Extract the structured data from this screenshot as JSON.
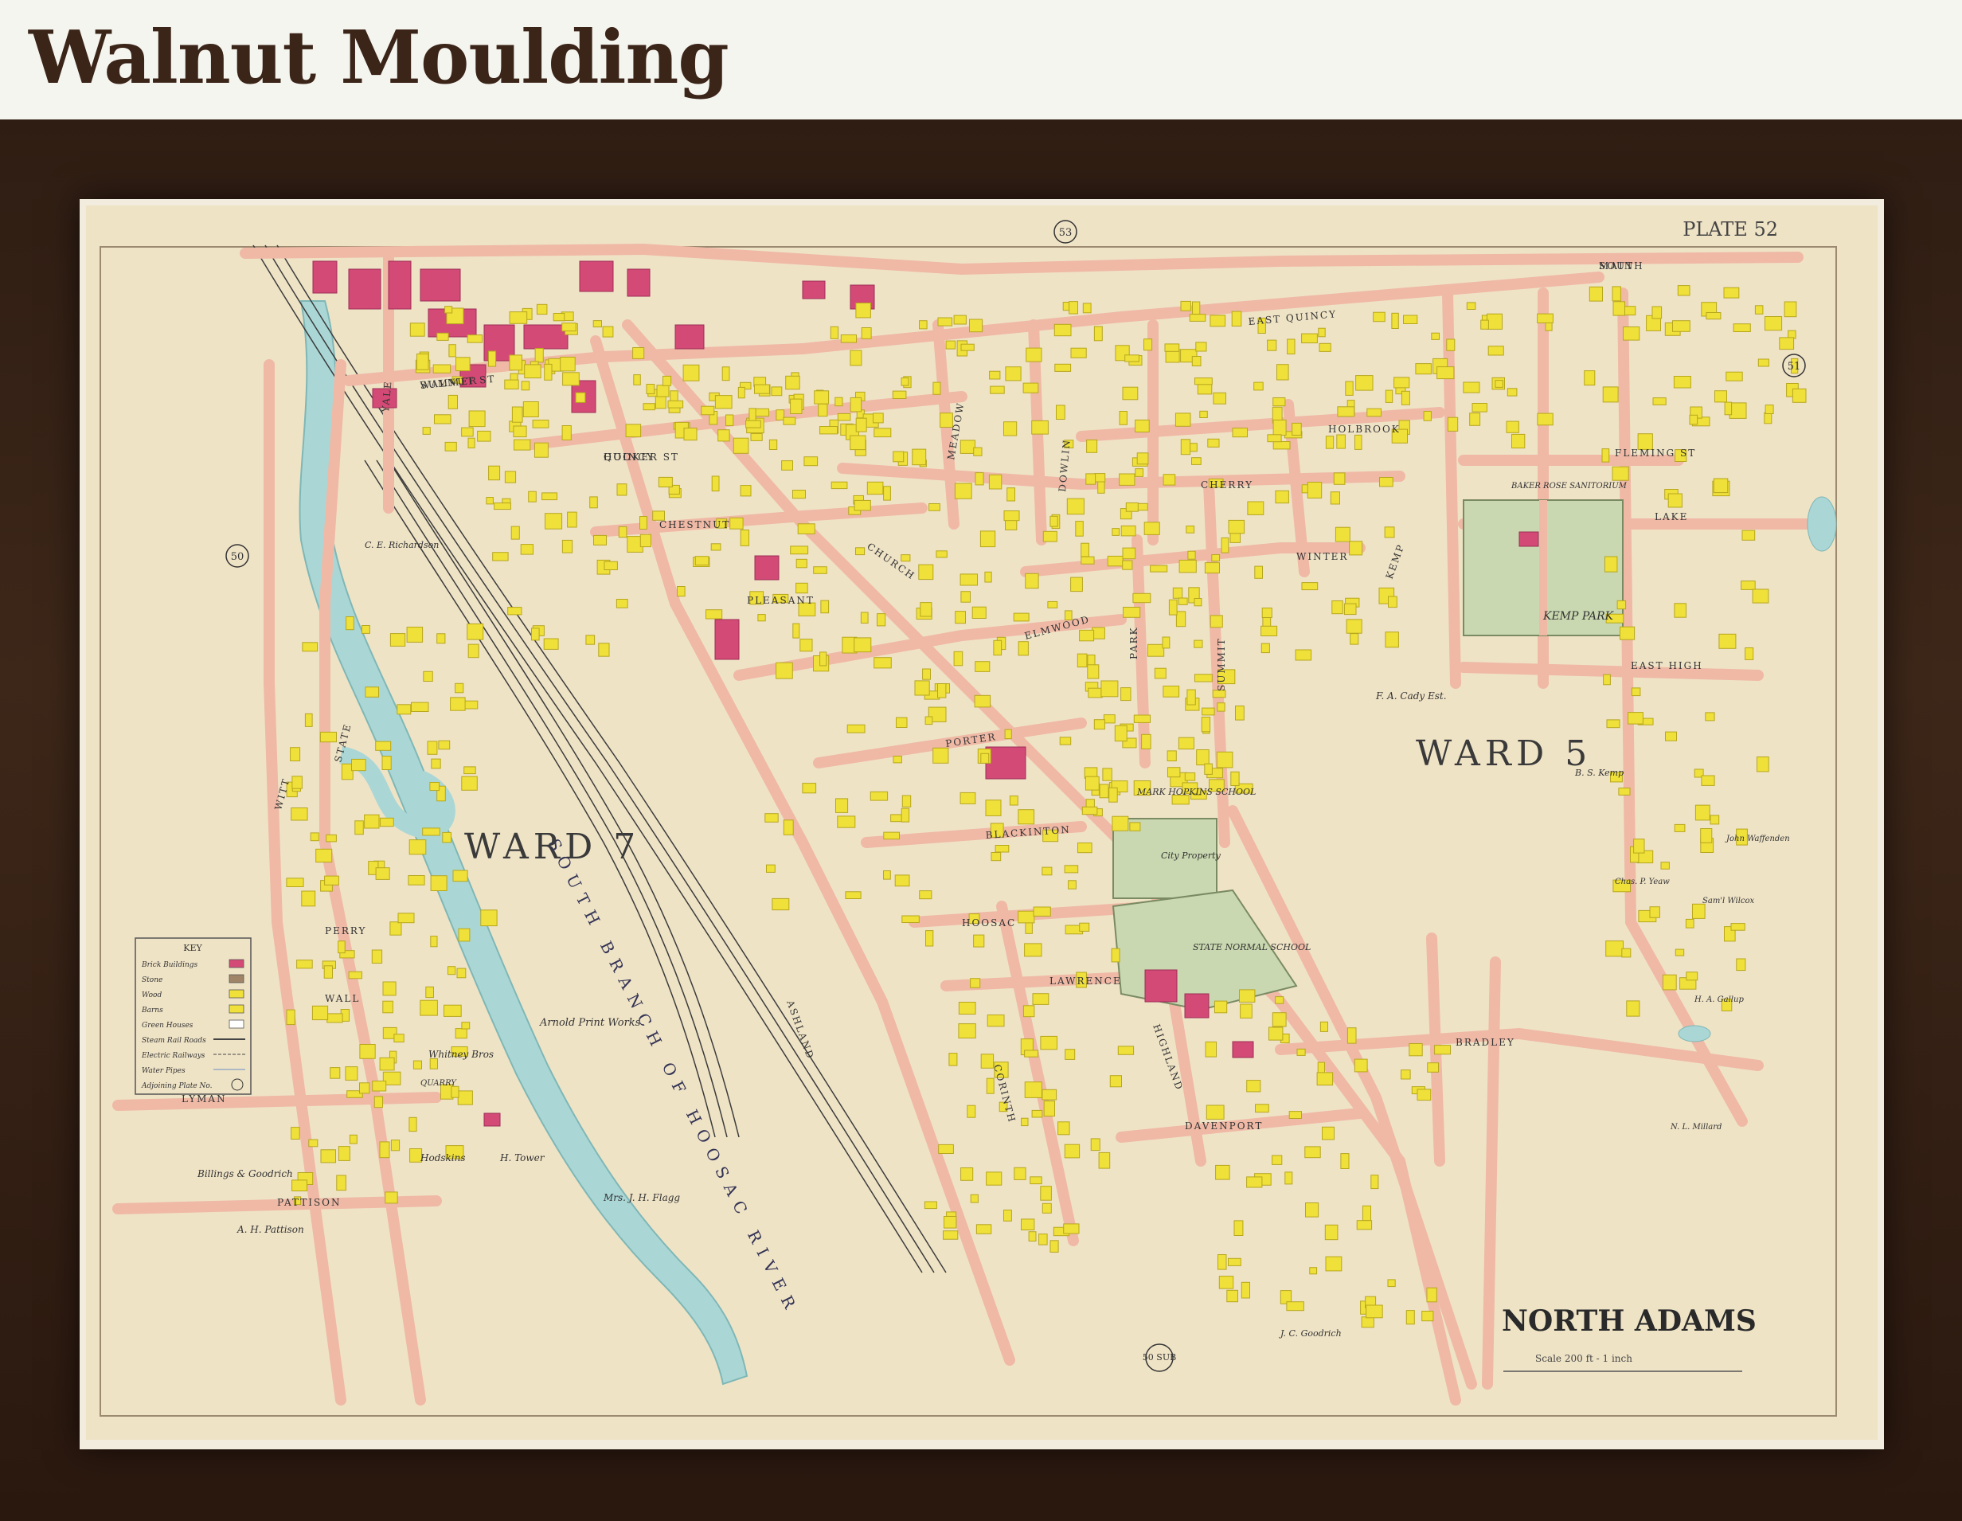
{
  "header": {
    "title": "Walnut Moulding"
  },
  "map": {
    "plate": "PLATE 52",
    "city": "NORTH ADAMS",
    "scale": "Scale 200 ft - 1 inch",
    "wards": [
      "WARD 7",
      "WARD 5"
    ],
    "river": "SOUTH BRANCH OF HOOSAC RIVER",
    "adjoining_plates": [
      "53",
      "51",
      "50",
      "50 SUB"
    ],
    "streets": [
      "MAIN",
      "SUMMER",
      "QUINCY",
      "CHESTNUT",
      "CHURCH",
      "EAST QUINCY",
      "HOLBROOK",
      "CHERRY",
      "WINTER",
      "ELMWOOD",
      "PORTER",
      "BLACKINTON",
      "HOOSAC",
      "LAWRENCE",
      "BRADLEY",
      "LYMAN",
      "PATTISON",
      "DAVENPORT",
      "EAST HIGH",
      "LAKE",
      "FLEMING ST",
      "WITT",
      "STATE",
      "ASHLAND",
      "CORINTH",
      "HIGHLAND",
      "SUMMIT",
      "PARK",
      "KEMP",
      "MEADOW",
      "DOWLIN",
      "YALE",
      "PLEASANT",
      "WALL",
      "PERRY",
      "SOUTH",
      "WALNUT ST",
      "HOOKER ST"
    ],
    "places": [
      "KEMP PARK",
      "BAKER ROSE SANITORIUM",
      "STATE NORMAL SCHOOL",
      "City Property",
      "MARK HOPKINS SCHOOL",
      "Arnold Print Works",
      "F. A. Cady Est.",
      "B. S. Kemp",
      "Billings & Goodrich",
      "A. H. Pattison",
      "Hodskins",
      "H. Tower",
      "Mrs. J. H. Flagg",
      "J. C. Goodrich",
      "Whitney Bros",
      "QUARRY",
      "C. E. Richardson",
      "N. L. Millard",
      "Sam'l Wilcox",
      "H. A. Gallup",
      "John Waffenden",
      "Chas. P. Yeaw"
    ],
    "key": {
      "title": "KEY",
      "items": [
        {
          "label": "Brick Buildings",
          "color": "#d44a76"
        },
        {
          "label": "Stone",
          "color": "#a08468"
        },
        {
          "label": "Wood",
          "color": "#f0e03a"
        },
        {
          "label": "Barns",
          "color": "#f0e03a"
        },
        {
          "label": "Green Houses",
          "color": "#ffffff"
        },
        {
          "label": "Steam Rail Roads",
          "color": "#444444"
        },
        {
          "label": "Electric Railways",
          "color": "#444444"
        },
        {
          "label": "Water Pipes",
          "color": "#6b8cc4"
        },
        {
          "label": "Adjoining Plate No.",
          "color": "#333333"
        }
      ]
    },
    "colors": {
      "paper": "#efe3c6",
      "street": "#efb9a6",
      "river": "#aad7d6",
      "brick": "#d44a76",
      "wood": "#f0e03a",
      "park": "#c9d8b0",
      "frame": "#3a2418"
    }
  }
}
